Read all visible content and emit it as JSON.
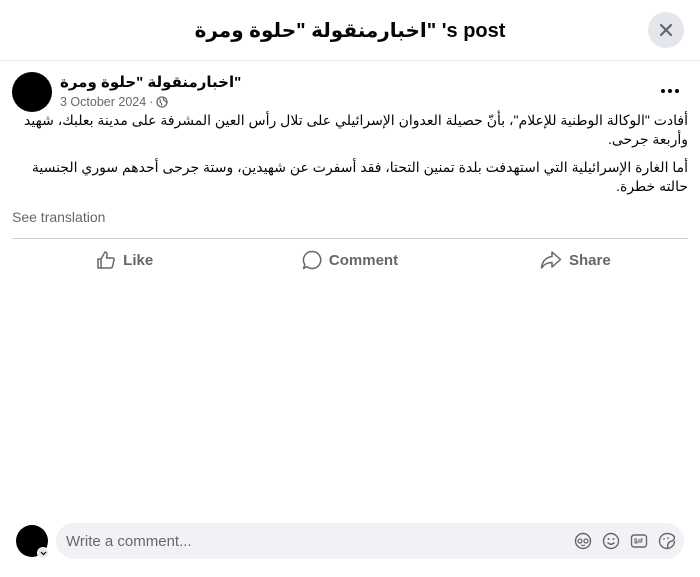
{
  "dialog": {
    "title": "اخبارمنقولة \"حلوة ومرة\" 's post"
  },
  "post": {
    "author": "اخبارمنقولة \"حلوة ومرة\"",
    "date": "3 October 2024",
    "separator": "·",
    "paragraph1": "أفادت \"الوكالة الوطنية للإعلام\"، بأنّ حصيلة العدوان الإسرائيلي على تلال رأس العين المشرفة على مدينة بعلبك، شهيد وأربعة جرحى.",
    "paragraph2": "أما الغارة الإسرائيلية التي استهدفت بلدة تمنين التحتا، فقد أسفرت عن شهيدين، وستة جرحى أحدهم سوري الجنسية حالته خطرة.",
    "see_translation": "See translation"
  },
  "actions": {
    "like": "Like",
    "comment": "Comment",
    "share": "Share"
  },
  "composer": {
    "placeholder": "Write a comment..."
  },
  "icons": {
    "close": "close-icon",
    "more": "more-options-icon",
    "privacy": "globe-icon",
    "like": "thumbs-up-icon",
    "comment": "speech-bubble-icon",
    "share": "share-arrow-icon",
    "avatar_sticker": "avatar-sticker-icon",
    "emoji": "emoji-icon",
    "gif": "gif-icon",
    "sticker": "sticker-icon"
  },
  "colors": {
    "secondary_text": "#65676b",
    "primary_text": "#050505",
    "divider": "#ced0d4",
    "input_bg": "#f0f2f5"
  }
}
